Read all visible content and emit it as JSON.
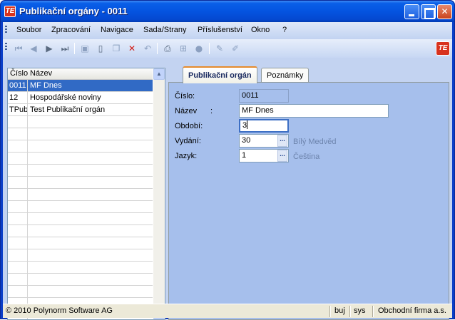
{
  "window": {
    "title": "Publikační orgány - 0011",
    "logo_text": "TE",
    "controls": [
      "minimize",
      "maximize",
      "close"
    ]
  },
  "menu": [
    "Soubor",
    "Zpracování",
    "Navigace",
    "Sada/Strany",
    "Příslušenství",
    "Okno",
    "?"
  ],
  "toolbar": {
    "icons": [
      "first-record-icon",
      "previous-record-icon",
      "next-record-icon",
      "last-record-icon",
      "save-icon",
      "new-record-icon",
      "copy-icon",
      "delete-icon",
      "undo-icon",
      "print-icon",
      "tree-icon",
      "record-icon",
      "edit-icon",
      "clear-icon"
    ],
    "brand_text": "TE"
  },
  "grid": {
    "columns": [
      "Číslo",
      "Název"
    ],
    "rows": [
      {
        "cislo": "0011",
        "nazev": "MF Dnes",
        "selected": true
      },
      {
        "cislo": "12",
        "nazev": "Hospodářské noviny",
        "selected": false
      },
      {
        "cislo": "TPub",
        "nazev": "Test Publikační orgán",
        "selected": false
      }
    ]
  },
  "tabs": [
    {
      "label": "Publikační orgán",
      "active": true
    },
    {
      "label": "Poznámky",
      "active": false
    }
  ],
  "form": {
    "cislo_label": "Číslo:",
    "cislo_value": "0011",
    "nazev_label": "Název",
    "nazev_colon": ":",
    "nazev_value": "MF Dnes",
    "obdobi_label": "Období:",
    "obdobi_value": "3",
    "vydani_label": "Vydání:",
    "vydani_value": "30",
    "vydani_hint": "Bílý Medvěd",
    "jazyk_label": "Jazyk:",
    "jazyk_value": "1",
    "jazyk_hint": "Čeština",
    "lookup_label": "..."
  },
  "status": {
    "copyright": "© 2010 Polynorm Software AG",
    "user": "buj",
    "db": "sys",
    "company": "Obchodní firma a.s."
  }
}
